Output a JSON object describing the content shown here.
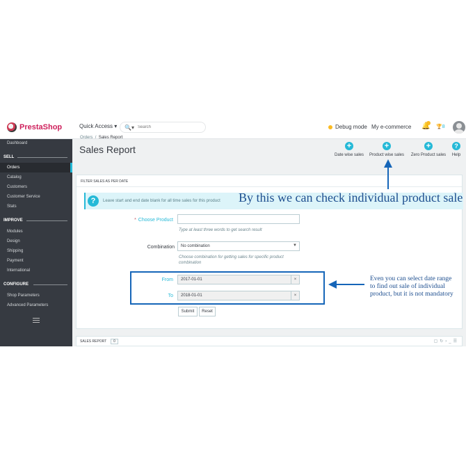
{
  "header": {
    "logo_text": "PrestaShop",
    "quick_access": "Quick Access ▾",
    "search_icon_glyph": "🔍▾",
    "search_placeholder": "Search",
    "debug_mode": "Debug mode",
    "shop_name": "My e-commerce",
    "notification_count": "8"
  },
  "sidebar": {
    "dashboard": "Dashboard",
    "sell": "SELL",
    "sell_items": [
      "Orders",
      "Catalog",
      "Customers",
      "Customer Service",
      "Stats"
    ],
    "improve": "IMPROVE",
    "improve_items": [
      "Modules",
      "Design",
      "Shipping",
      "Payment",
      "International"
    ],
    "configure": "CONFIGURE",
    "configure_items": [
      "Shop Parameters",
      "Advanced Parameters"
    ],
    "active_item": "Orders"
  },
  "breadcrumb": {
    "parent": "Orders",
    "separator": "/",
    "current": "Sales Report"
  },
  "page_title": "Sales Report",
  "toolbar": [
    {
      "label": "Date wise sales",
      "icon": "plus-circle-icon",
      "glyph": "+"
    },
    {
      "label": "Product wise sales",
      "icon": "plus-circle-icon",
      "glyph": "+"
    },
    {
      "label": "Zero Product sales",
      "icon": "plus-circle-icon",
      "glyph": "+"
    },
    {
      "label": "Help",
      "icon": "help-circle-icon",
      "glyph": "?"
    }
  ],
  "panel": {
    "heading": "FILTER SALES AS PER DATE",
    "alert_icon": "?",
    "alert_text": "Leave start and end date blank for all time sales for this product",
    "required_mark": "*",
    "choose_product_label": "Choose Product",
    "choose_product_value": "",
    "choose_product_hint": "Type at least three words to get search result",
    "combination_label": "Combination",
    "combination_value": "No combination",
    "combination_hint_1": "Choose combination for getting sales for specific product",
    "combination_hint_2": "combination",
    "from_label": "From",
    "from_value": "2017-01-01",
    "to_label": "To",
    "to_value": "2018-01-01",
    "clear_glyph": "×",
    "submit_label": "Submit",
    "reset_label": "Reset"
  },
  "bottom": {
    "title": "SALES REPORT",
    "count": "0"
  },
  "annotations": {
    "top": "By this we can check individual product sale",
    "side_1": "Even you can select date range",
    "side_2": "to find out sale of individual",
    "side_3": "product, but it is not mandatory"
  },
  "colors": {
    "accent": "#25b9d7",
    "sidebar_bg": "#363a41",
    "annotation": "#1d4e8f",
    "brand": "#ce1f5b"
  }
}
